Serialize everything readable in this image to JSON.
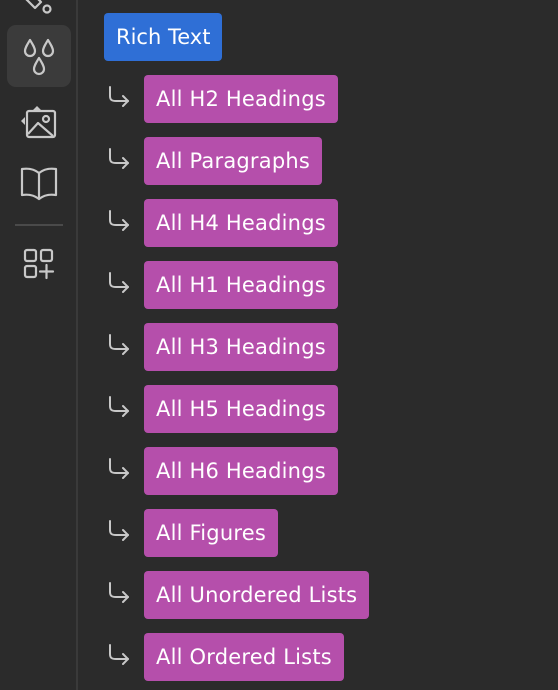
{
  "rail": {
    "items": [
      {
        "icon": "paint-bucket-icon",
        "active": false
      },
      {
        "icon": "droplets-icon",
        "active": true
      },
      {
        "icon": "image-icon",
        "active": false
      },
      {
        "icon": "book-icon",
        "active": false
      },
      {
        "icon": "add-apps-icon",
        "active": false
      }
    ]
  },
  "selector": {
    "root_label": "Rich Text",
    "children": [
      {
        "label": "All H2 Headings"
      },
      {
        "label": "All Paragraphs"
      },
      {
        "label": "All H4 Headings"
      },
      {
        "label": "All H1 Headings"
      },
      {
        "label": "All H3 Headings"
      },
      {
        "label": "All H5 Headings"
      },
      {
        "label": "All H6 Headings"
      },
      {
        "label": "All Figures"
      },
      {
        "label": "All Unordered Lists"
      },
      {
        "label": "All Ordered Lists"
      }
    ]
  },
  "colors": {
    "background": "#2b2b2b",
    "root_chip": "#2f6fd6",
    "child_chip": "#b54fab",
    "icon": "#c8c8c8"
  }
}
